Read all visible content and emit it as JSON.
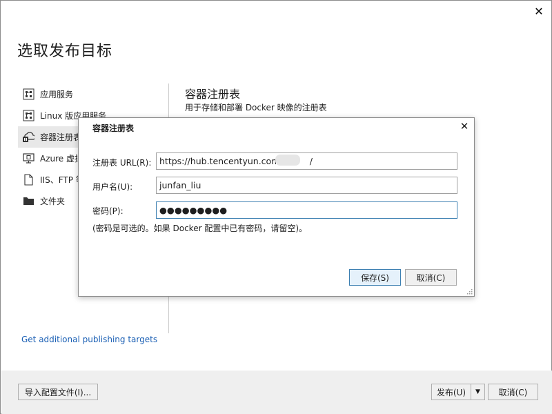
{
  "window": {
    "close_glyph": "✕",
    "title": "选取发布目标"
  },
  "targets": [
    {
      "label": "应用服务",
      "icon": "app-service-icon"
    },
    {
      "label": "Linux 版应用服务",
      "icon": "linux-app-service-icon"
    },
    {
      "label": "容器注册表",
      "icon": "container-registry-icon",
      "selected": true
    },
    {
      "label": "Azure 虚拟机",
      "icon": "virtual-machine-icon"
    },
    {
      "label": "IIS、FTP 等",
      "icon": "file-icon"
    },
    {
      "label": "文件夹",
      "icon": "folder-icon"
    }
  ],
  "detail": {
    "title": "容器注册表",
    "subtitle": "用于存储和部署 Docker 映像的注册表"
  },
  "more_link": "Get additional publishing targets",
  "footer": {
    "import_label": "导入配置文件(I)...",
    "publish_label": "发布(U)",
    "publish_arrow": "▼",
    "cancel_label": "取消(C)"
  },
  "dialog": {
    "title": "容器注册表",
    "close_glyph": "✕",
    "registry_url_label": "注册表 URL(R):",
    "registry_url_value": "https://hub.tencentyun.com/v        /",
    "username_label": "用户名(U):",
    "username_value": "junfan_liu",
    "password_label": "密码(P):",
    "password_value": "●●●●●●●●●",
    "hint": "(密码是可选的。如果 Docker 配置中已有密码，请留空)。",
    "save_label": "保存(S)",
    "cancel_label": "取消(C)"
  },
  "colors": {
    "link": "#1a5fb4",
    "focus_border": "#3c7fb1",
    "selected_bg": "#e8e8e8"
  }
}
